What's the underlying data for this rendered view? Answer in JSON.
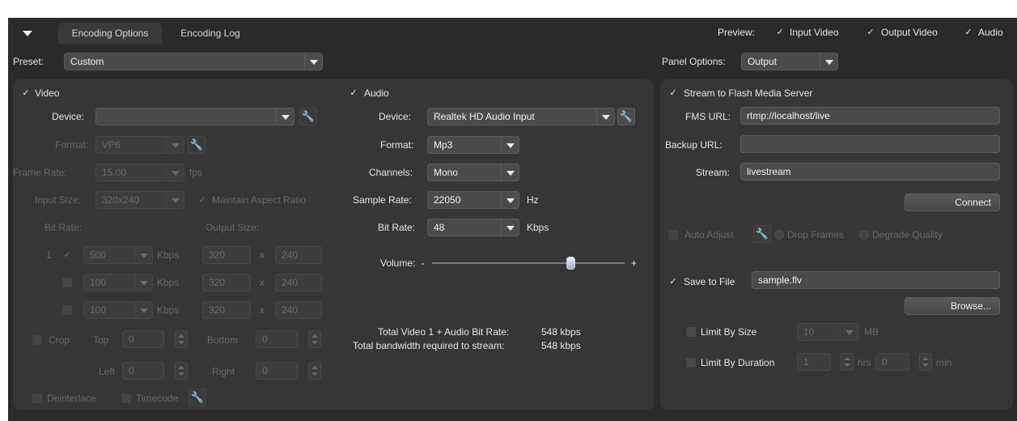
{
  "tabs": {
    "encoding_options": "Encoding Options",
    "encoding_log": "Encoding Log"
  },
  "preview": {
    "label": "Preview:",
    "input_video": "Input Video",
    "output_video": "Output Video",
    "audio": "Audio"
  },
  "preset": {
    "label": "Preset:",
    "value": "Custom"
  },
  "panel_options": {
    "label": "Panel Options:",
    "value": "Output"
  },
  "video": {
    "title": "Video",
    "device_label": "Device:",
    "device_value": "",
    "format_label": "Format:",
    "format_value": "VP6",
    "frame_rate_label": "Frame Rate:",
    "frame_rate_value": "15.00",
    "frame_rate_unit": "fps",
    "input_size_label": "Input Size:",
    "input_size_value": "320x240",
    "maintain_aspect": "Maintain Aspect Ratio",
    "bit_rate_header": "Bit Rate:",
    "output_size_header": "Output Size:",
    "rows": [
      {
        "index": "1",
        "bitrate": "500",
        "unit": "Kbps",
        "w": "320",
        "x": "x",
        "h": "240"
      },
      {
        "index": "",
        "bitrate": "100",
        "unit": "Kbps",
        "w": "320",
        "x": "x",
        "h": "240"
      },
      {
        "index": "",
        "bitrate": "100",
        "unit": "Kbps",
        "w": "320",
        "x": "x",
        "h": "240"
      }
    ],
    "crop_label": "Crop",
    "top_label": "Top",
    "top_value": "0",
    "bottom_label": "Bottom",
    "bottom_value": "0",
    "left_label": "Left",
    "left_value": "0",
    "right_label": "Right",
    "right_value": "0",
    "deinterlace": "Deinterlace",
    "timecode": "Timecode"
  },
  "audio": {
    "title": "Audio",
    "device_label": "Device:",
    "device_value": "Realtek HD Audio Input",
    "format_label": "Format:",
    "format_value": "Mp3",
    "channels_label": "Channels:",
    "channels_value": "Mono",
    "sample_rate_label": "Sample Rate:",
    "sample_rate_value": "22050",
    "sample_rate_unit": "Hz",
    "bit_rate_label": "Bit Rate:",
    "bit_rate_value": "48",
    "bit_rate_unit": "Kbps",
    "volume_label": "Volume:",
    "volume_minus": "-",
    "volume_plus": "+",
    "volume_level": 0.72,
    "total_bitrate_label": "Total Video 1 + Audio Bit Rate:",
    "total_bitrate_value": "548 kbps",
    "total_bandwidth_label": "Total bandwidth required to stream:",
    "total_bandwidth_value": "548 kbps"
  },
  "output": {
    "stream_to_fms": "Stream to Flash Media Server",
    "fms_url_label": "FMS URL:",
    "fms_url_value": "rtmp://localhost/live",
    "backup_url_label": "Backup URL:",
    "backup_url_value": "",
    "stream_label": "Stream:",
    "stream_value": "livestream",
    "connect": "Connect",
    "auto_adjust": "Auto Adjust",
    "drop_frames": "Drop Frames",
    "degrade_quality": "Degrade Quality",
    "save_to_file": "Save to File",
    "file_value": "sample.flv",
    "browse": "Browse...",
    "limit_by_size": "Limit By Size",
    "size_value": "10",
    "size_unit": "MB",
    "limit_by_duration": "Limit By Duration",
    "hrs_value": "1",
    "hrs_unit": "hrs",
    "min_value": "0",
    "min_unit": "min"
  }
}
